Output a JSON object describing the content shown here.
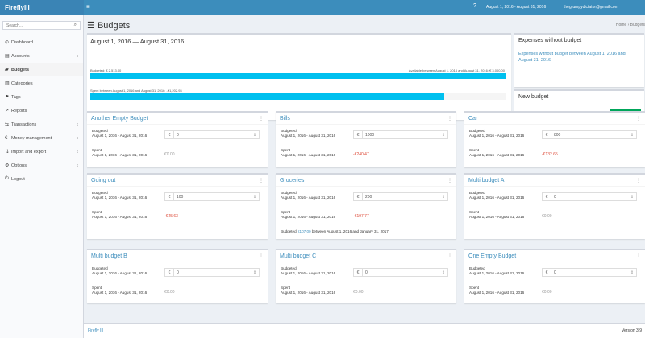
{
  "app": {
    "logo": "FireflyIII",
    "toggle_icon": "≡"
  },
  "topbar": {
    "help_icon": "?",
    "date_range": "August 1, 2016 - August 31, 2016",
    "user_email": "thegrumpydictator@gmail.com"
  },
  "sidebar": {
    "search_placeholder": "Search...",
    "search_icon": "⌕",
    "items": [
      {
        "icon": "⊙",
        "label": "Dashboard",
        "chev": ""
      },
      {
        "icon": "▤",
        "label": "Accounts",
        "chev": "‹"
      },
      {
        "icon": "▰",
        "label": "Budgets",
        "chev": ""
      },
      {
        "icon": "▥",
        "label": "Categories",
        "chev": ""
      },
      {
        "icon": "⚑",
        "label": "Tags",
        "chev": ""
      },
      {
        "icon": "↗",
        "label": "Reports",
        "chev": ""
      },
      {
        "icon": "⇆",
        "label": "Transactions",
        "chev": "‹"
      },
      {
        "icon": "€",
        "label": "Money management",
        "chev": "‹"
      },
      {
        "icon": "⇅",
        "label": "Import and export",
        "chev": "‹"
      },
      {
        "icon": "⚙",
        "label": "Options",
        "chev": "‹"
      },
      {
        "icon": "⏻",
        "label": "Logout",
        "chev": ""
      }
    ]
  },
  "page": {
    "title_icon": "☰",
    "title": "Budgets",
    "breadcrumb_home": "Home",
    "breadcrumb_current": "Budgets"
  },
  "overview": {
    "title": "August 1, 2016 — August 31, 2016",
    "budgeted_label": "Budgeted: € 2,513.00",
    "available_label": "Available between August 1, 2016 and August 31, 2016: € 3,000.00",
    "budgeted_fill": 1.0,
    "spent_label": "Spent between August 1, 2016 and August 31, 2016: -€1,202.93",
    "spent_fill": 0.85
  },
  "expenses_without": {
    "title": "Expenses without budget",
    "link": "Expenses without budget between August 1, 2016 and August 31, 2016"
  },
  "new_budget": {
    "title": "New budget",
    "button": "New budget"
  },
  "budgets": [
    {
      "name": "Another Empty Budget",
      "budgeted": "Budgeted",
      "range": "August 1, 2016 - August 31, 2016",
      "currency": "€",
      "amount": "0",
      "spent_label": "Spent",
      "spent_range": "August 1, 2016 - August 31, 2016",
      "spent": "€0.00",
      "spent_class": "neutral",
      "menu": "⋮",
      "spin": "⇕"
    },
    {
      "name": "Bills",
      "budgeted": "Budgeted",
      "range": "August 1, 2016 - August 31, 2016",
      "currency": "€",
      "amount": "1000",
      "spent_label": "Spent",
      "spent_range": "August 1, 2016 - August 31, 2016",
      "spent": "-€240.47",
      "spent_class": "neg",
      "menu": "⋮",
      "spin": "⇕"
    },
    {
      "name": "Car",
      "budgeted": "Budgeted",
      "range": "August 1, 2016 - August 31, 2016",
      "currency": "€",
      "amount": "800",
      "spent_label": "Spent",
      "spent_range": "August 1, 2016 - August 31, 2016",
      "spent": "-€132.65",
      "spent_class": "neg",
      "menu": "⋮",
      "spin": "⇕"
    },
    {
      "name": "Going out",
      "budgeted": "Budgeted",
      "range": "August 1, 2016 - August 31, 2016",
      "currency": "€",
      "amount": "100",
      "spent_label": "Spent",
      "spent_range": "August 1, 2016 - August 31, 2016",
      "spent": "-€45.63",
      "spent_class": "neg",
      "menu": "⋮",
      "spin": "⇕"
    },
    {
      "name": "Groceries",
      "budgeted": "Budgeted",
      "range": "August 1, 2016 - August 31, 2016",
      "currency": "€",
      "amount": "200",
      "spent_label": "Spent",
      "spent_range": "August 1, 2016 - August 31, 2016",
      "spent": "-€197.77",
      "spent_class": "neg",
      "menu": "⋮",
      "spin": "⇕",
      "note_prefix": "Budgeted ",
      "note_link": "€107.00",
      "note_suffix": " between August 1, 2016 and January 31, 2017"
    },
    {
      "name": "Multi budget A",
      "budgeted": "Budgeted",
      "range": "August 1, 2016 - August 31, 2016",
      "currency": "€",
      "amount": "0",
      "spent_label": "Spent",
      "spent_range": "August 1, 2016 - August 31, 2016",
      "spent": "€0.00",
      "spent_class": "neutral",
      "menu": "⋮",
      "spin": "⇕"
    },
    {
      "name": "Multi budget B",
      "budgeted": "Budgeted",
      "range": "August 1, 2016 - August 31, 2016",
      "currency": "€",
      "amount": "0",
      "spent_label": "Spent",
      "spent_range": "August 1, 2016 - August 31, 2016",
      "spent": "€0.00",
      "spent_class": "neutral",
      "menu": "⋮",
      "spin": "⇕"
    },
    {
      "name": "Multi budget C",
      "budgeted": "Budgeted",
      "range": "August 1, 2016 - August 31, 2016",
      "currency": "€",
      "amount": "0",
      "spent_label": "Spent",
      "spent_range": "August 1, 2016 - August 31, 2016",
      "spent": "€0.00",
      "spent_class": "neutral",
      "menu": "⋮",
      "spin": "⇕"
    },
    {
      "name": "One Empty Budget",
      "budgeted": "Budgeted",
      "range": "August 1, 2016 - August 31, 2016",
      "currency": "€",
      "amount": "0",
      "spent_label": "Spent",
      "spent_range": "August 1, 2016 - August 31, 2016",
      "spent": "€0.00",
      "spent_class": "neutral",
      "menu": "⋮",
      "spin": "⇕"
    }
  ],
  "footer": {
    "left": "Firefly III",
    "right": "Version 3.9"
  },
  "colors": {
    "topbar": "#3c8dbc",
    "logo_bg": "#3a84b5",
    "progress": "#00c0ef",
    "button": "#00a65a",
    "negative": "#dd4b39"
  }
}
